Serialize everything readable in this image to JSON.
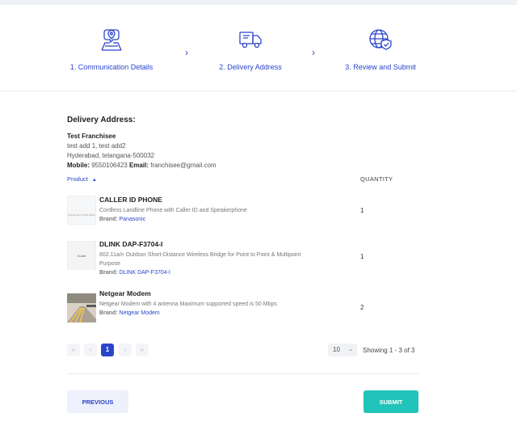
{
  "steps": [
    {
      "label": "1. Communication Details",
      "icon": "chat-location-icon"
    },
    {
      "label": "2. Delivery Address",
      "icon": "delivery-truck-icon"
    },
    {
      "label": "3. Review and Submit",
      "icon": "globe-shield-icon"
    }
  ],
  "step_arrow": "›",
  "delivery": {
    "title": "Delivery Address:",
    "name": "Test Franchisee",
    "line1": "test add 1, test add2",
    "line2": "Hyderabad, telangana-500032",
    "mobile_label": "Mobile:",
    "mobile": "9550106423",
    "email_label": "Email:",
    "email": "franchisee@gmail.com"
  },
  "table": {
    "col_product": "Product",
    "col_quantity": "QUANTITY",
    "sort_icon": "▲",
    "brand_label": "Brand:",
    "rows": [
      {
        "name": "CALLER ID PHONE",
        "desc": "Cordless Landline Phone with Caller ID and Speakerphone",
        "brand": "Panasonic",
        "qty": "1",
        "thumb": "IMAGE NOT AVAILABLE"
      },
      {
        "name": "DLINK DAP-F3704-I",
        "desc": "802.11a/n Outdoor Short-Distance Wireless Bridge for Point to Point & Multipoint Purpose",
        "brand": "DLINK DAP-F3704-I",
        "qty": "1",
        "thumb": "D-Link"
      },
      {
        "name": "Netgear Modem",
        "desc": "Netgear Modem with 4 antenna Maximum supported speed is 50 Mbps",
        "brand": "Netgear Modem",
        "qty": "2",
        "thumb": ""
      }
    ]
  },
  "pagination": {
    "first": "«",
    "prev": "‹",
    "current": "1",
    "next": "›",
    "last": "»",
    "per_page": "10",
    "showing": "Showing 1 - 3 of 3"
  },
  "buttons": {
    "previous": "PREVIOUS",
    "submit": "SUBMIT"
  },
  "colors": {
    "accent": "#2b45c9",
    "submit": "#22c3b8"
  }
}
